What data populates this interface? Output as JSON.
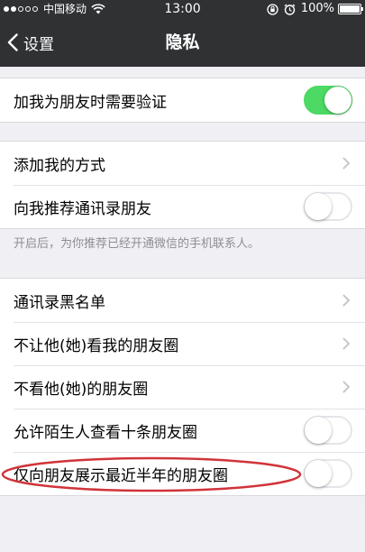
{
  "status_bar": {
    "signal_dots": [
      true,
      true,
      false,
      false,
      false
    ],
    "carrier": "中国移动",
    "time": "13:00",
    "battery": "100%",
    "icons": [
      "wifi-icon",
      "rotation-lock-icon",
      "alarm-icon",
      "battery-icon"
    ]
  },
  "nav": {
    "back_label": "设置",
    "title": "隐私"
  },
  "groups": [
    {
      "rows": [
        {
          "label": "加我为朋友时需要验证",
          "control": "toggle",
          "on": true
        }
      ]
    },
    {
      "rows": [
        {
          "label": "添加我的方式",
          "control": "chevron"
        },
        {
          "label": "向我推荐通讯录朋友",
          "control": "toggle",
          "on": false
        }
      ],
      "footnote": "开启后，为你推荐已经开通微信的手机联系人。"
    },
    {
      "rows": [
        {
          "label": "通讯录黑名单",
          "control": "chevron"
        },
        {
          "label": "不让他(她)看我的朋友圈",
          "control": "chevron"
        },
        {
          "label": "不看他(她)的朋友圈",
          "control": "chevron"
        },
        {
          "label": "允许陌生人查看十条朋友圈",
          "control": "toggle",
          "on": false
        },
        {
          "label": "仅向朋友展示最近半年的朋友圈",
          "control": "toggle",
          "on": false
        }
      ]
    }
  ],
  "colors": {
    "nav_background": "#2f3133",
    "page_background": "#efeff4",
    "toggle_on": "#4cd964",
    "annotation": "#d0343a"
  }
}
